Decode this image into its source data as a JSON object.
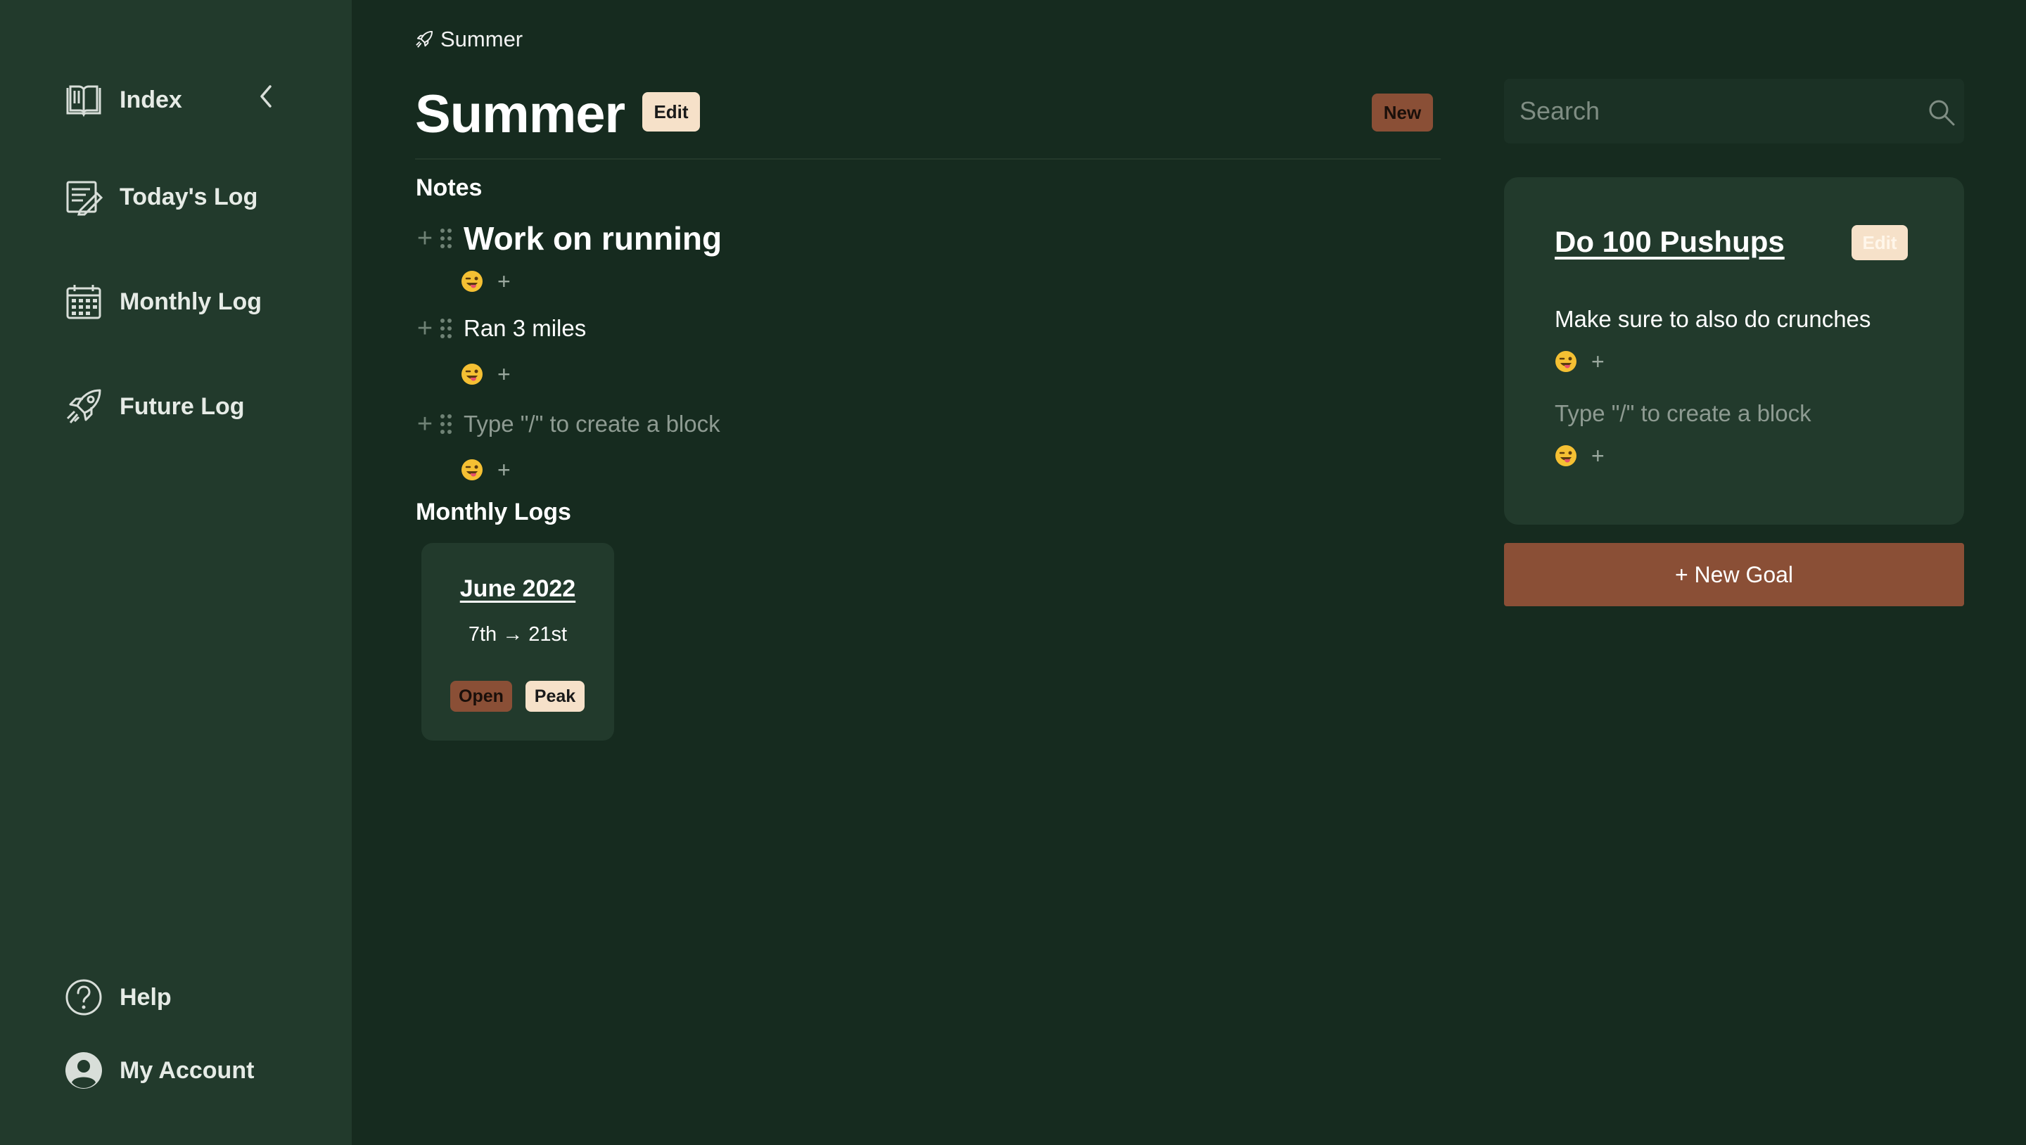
{
  "sidebar": {
    "items": [
      {
        "label": "Index",
        "icon": "book-icon"
      },
      {
        "label": "Today's Log",
        "icon": "notebook-pen-icon"
      },
      {
        "label": "Monthly Log",
        "icon": "calendar-icon"
      },
      {
        "label": "Future Log",
        "icon": "rocket-icon"
      }
    ],
    "bottom_items": [
      {
        "label": "Help",
        "icon": "help-circle-icon"
      },
      {
        "label": "My Account",
        "icon": "user-circle-icon"
      }
    ]
  },
  "breadcrumb": {
    "label": "Summer",
    "icon": "rocket-icon"
  },
  "header": {
    "title": "Summer",
    "edit_label": "Edit",
    "new_label": "New"
  },
  "notes": {
    "heading": "Notes",
    "blocks": [
      {
        "text": "Work on running",
        "style": "heading",
        "reaction": "😜"
      },
      {
        "text": "Ran 3 miles",
        "style": "normal",
        "reaction": "😜"
      },
      {
        "placeholder": "Type \"/\" to create a block",
        "style": "placeholder",
        "reaction": "😜"
      }
    ]
  },
  "monthly_logs": {
    "heading": "Monthly Logs",
    "cards": [
      {
        "title": "June 2022",
        "range": "7th → 21st",
        "open_label": "Open",
        "peak_label": "Peak"
      }
    ]
  },
  "search": {
    "placeholder": "Search"
  },
  "goal": {
    "title": "Do 100 Pushups",
    "edit_label": "Edit",
    "blocks": [
      {
        "text": "Make sure to also do crunches",
        "reaction": "😜"
      },
      {
        "placeholder": "Type \"/\" to create a block",
        "reaction": "😜"
      }
    ]
  },
  "new_goal_label": "+ New Goal",
  "colors": {
    "background": "#162b1f",
    "sidebar": "#223a2c",
    "accent_brown": "#8a4f36",
    "accent_cream": "#f6e1c9"
  }
}
